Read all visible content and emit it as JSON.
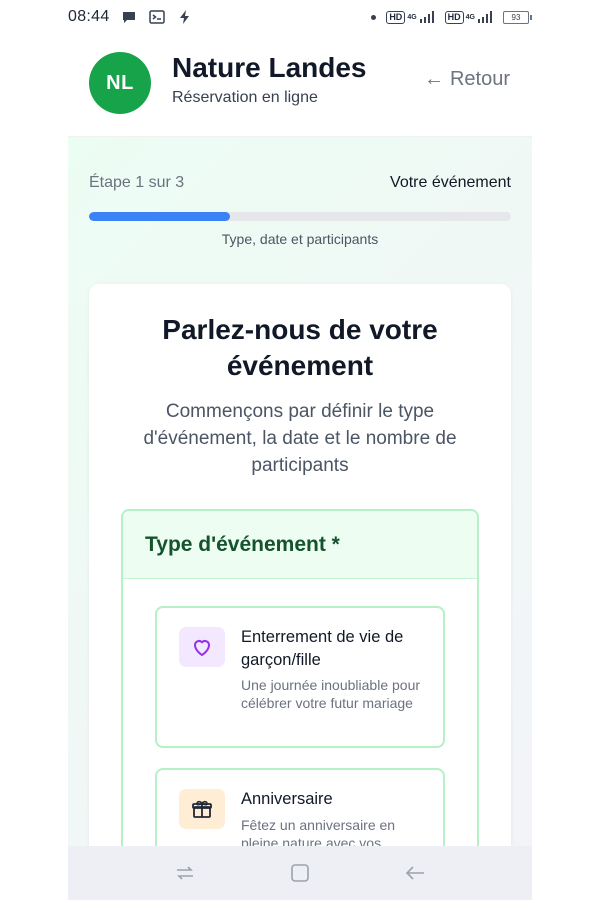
{
  "status_bar": {
    "time": "08:44",
    "net1": "HD",
    "net1_gen": "4G",
    "net2": "HD",
    "net2_gen": "4G",
    "battery": "93"
  },
  "header": {
    "avatar_initials": "NL",
    "brand": "Nature Landes",
    "subtitle": "Réservation en ligne",
    "back_label": "Retour",
    "back_arrow": "←"
  },
  "progress": {
    "step_label": "Étape 1 sur 3",
    "step_name": "Votre événement",
    "caption": "Type, date et participants",
    "fraction": 0.333
  },
  "card": {
    "title": "Parlez-nous de votre événement",
    "subtitle": "Commençons par définir le type d'événement, la date et le nombre de participants"
  },
  "event_type": {
    "heading": "Type d'événement *",
    "options": [
      {
        "icon": "heart-icon",
        "title": "Enterrement de vie de garçon/fille",
        "description": "Une journée inoubliable pour célébrer votre futur mariage"
      },
      {
        "icon": "gift-icon",
        "title": "Anniversaire",
        "description": "Fêtez un anniversaire en pleine nature avec vos"
      }
    ]
  },
  "colors": {
    "brand_green": "#16a34a",
    "progress_blue": "#3b82f6",
    "section_border": "#b5f0c6"
  }
}
